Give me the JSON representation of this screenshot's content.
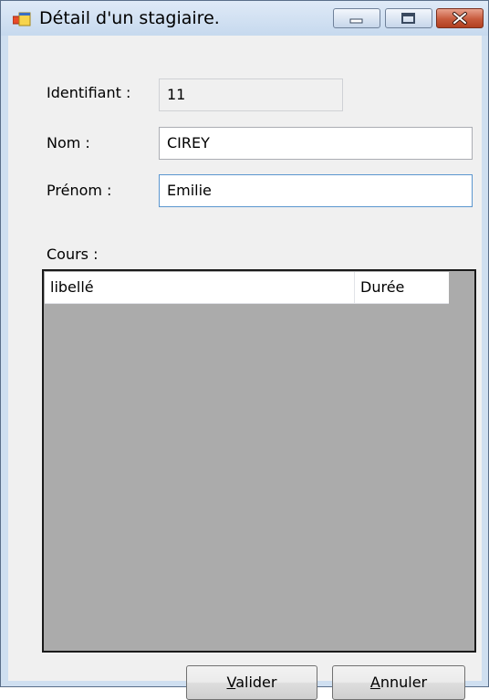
{
  "window": {
    "title": "Détail d'un stagiaire."
  },
  "form": {
    "identifiant_label": "Identifiant :",
    "identifiant_value": "11",
    "nom_label": "Nom :",
    "nom_value": "CIREY",
    "prenom_label": "Prénom :",
    "prenom_value": "Emilie",
    "cours_label": "Cours :"
  },
  "cours_list": {
    "columns": [
      "libellé",
      "Durée"
    ],
    "rows": []
  },
  "buttons": {
    "valider": {
      "first": "V",
      "rest": "alider"
    },
    "annuler": {
      "first": "A",
      "rest": "nnuler"
    }
  },
  "colors": {
    "titlebar": "#cfdff0",
    "close_button": "#c75a3c",
    "list_background": "#ababab",
    "client_background": "#f0f0f0"
  }
}
